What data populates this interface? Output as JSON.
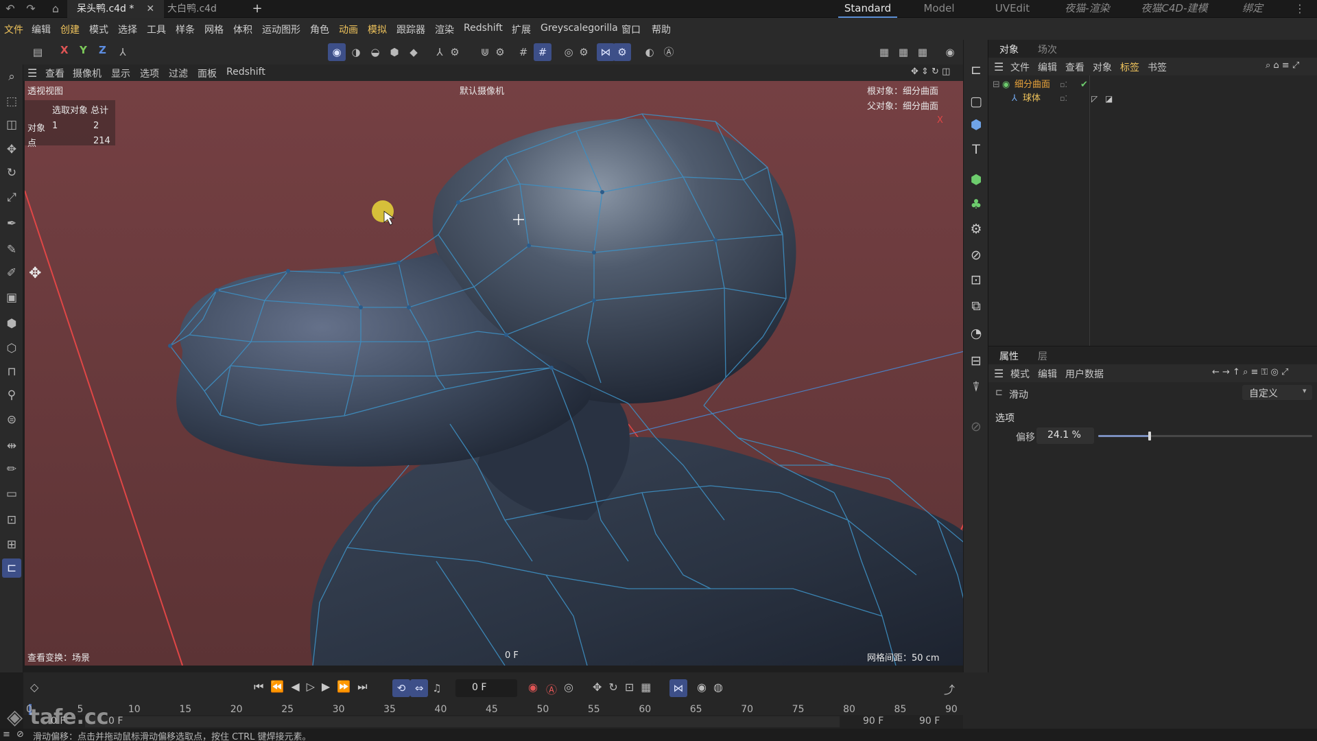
{
  "top_tabs": {
    "active_doc": "呆头鸭.c4d *",
    "doc2": "大白鸭.c4d",
    "add": "+",
    "layouts": [
      "Standard",
      "Model",
      "UVEdit",
      "夜猫-渲染",
      "夜猫C4D-建模",
      "绑定"
    ]
  },
  "menu": [
    "文件",
    "编辑",
    "创建",
    "模式",
    "选择",
    "工具",
    "样条",
    "网格",
    "体积",
    "运动图形",
    "角色",
    "动画",
    "模拟",
    "跟踪器",
    "渲染",
    "Redshift",
    "扩展",
    "Greyscalegorilla",
    "窗口",
    "帮助"
  ],
  "axes": {
    "x": "X",
    "y": "Y",
    "z": "Z"
  },
  "viewport_menu": [
    "查看",
    "摄像机",
    "显示",
    "选项",
    "过滤",
    "面板",
    "Redshift"
  ],
  "viewport": {
    "view_name": "透视视图",
    "camera": "默认摄像机",
    "hud_header": "选取对象 总计",
    "hud_rows": [
      {
        "label": "对象",
        "selected": "1",
        "total": "2"
      },
      {
        "label": "点",
        "selected": "",
        "total": "214"
      }
    ],
    "root_object": "根对象：细分曲面",
    "parent_object": "父对象：细分曲面",
    "bottom_left": "查看变换：场景",
    "bottom_center": "0 F",
    "grid_spacing": "网格间距：50 cm",
    "axis_x": "X"
  },
  "object_manager": {
    "tabs": [
      "对象",
      "场次"
    ],
    "menu": [
      "文件",
      "编辑",
      "查看",
      "对象",
      "标签",
      "书签"
    ],
    "items": [
      {
        "name": "细分曲面",
        "color": "#e8a23a"
      },
      {
        "name": "球体",
        "color": "#f0c45c"
      }
    ]
  },
  "attribute_manager": {
    "tabs": [
      "属性",
      "层"
    ],
    "menu": [
      "模式",
      "编辑",
      "用户数据"
    ],
    "tool_name": "滑动",
    "preset": "自定义",
    "section": "选项",
    "offset_label": "偏移",
    "offset_value": "24.1 %",
    "offset_fraction": 0.241
  },
  "timeline": {
    "current_frame": "0 F",
    "ruler_ticks": [
      "0",
      "5",
      "10",
      "15",
      "20",
      "25",
      "30",
      "35",
      "40",
      "45",
      "50",
      "55",
      "60",
      "65",
      "70",
      "75",
      "80",
      "85",
      "90"
    ],
    "range_start": "0 F",
    "range_start2": "0 F",
    "range_end": "90 F",
    "range_end2": "90 F"
  },
  "status": "滑动偏移：点击并拖动鼠标滑动偏移选取点，按住 CTRL 键焊接元素。",
  "watermark": "tafe.cc",
  "colors": {
    "accent": "#3d4f88",
    "highlight": "#f0c45c",
    "viewport_bg": "#6b3b3d",
    "wire": "#3e8fc2"
  }
}
